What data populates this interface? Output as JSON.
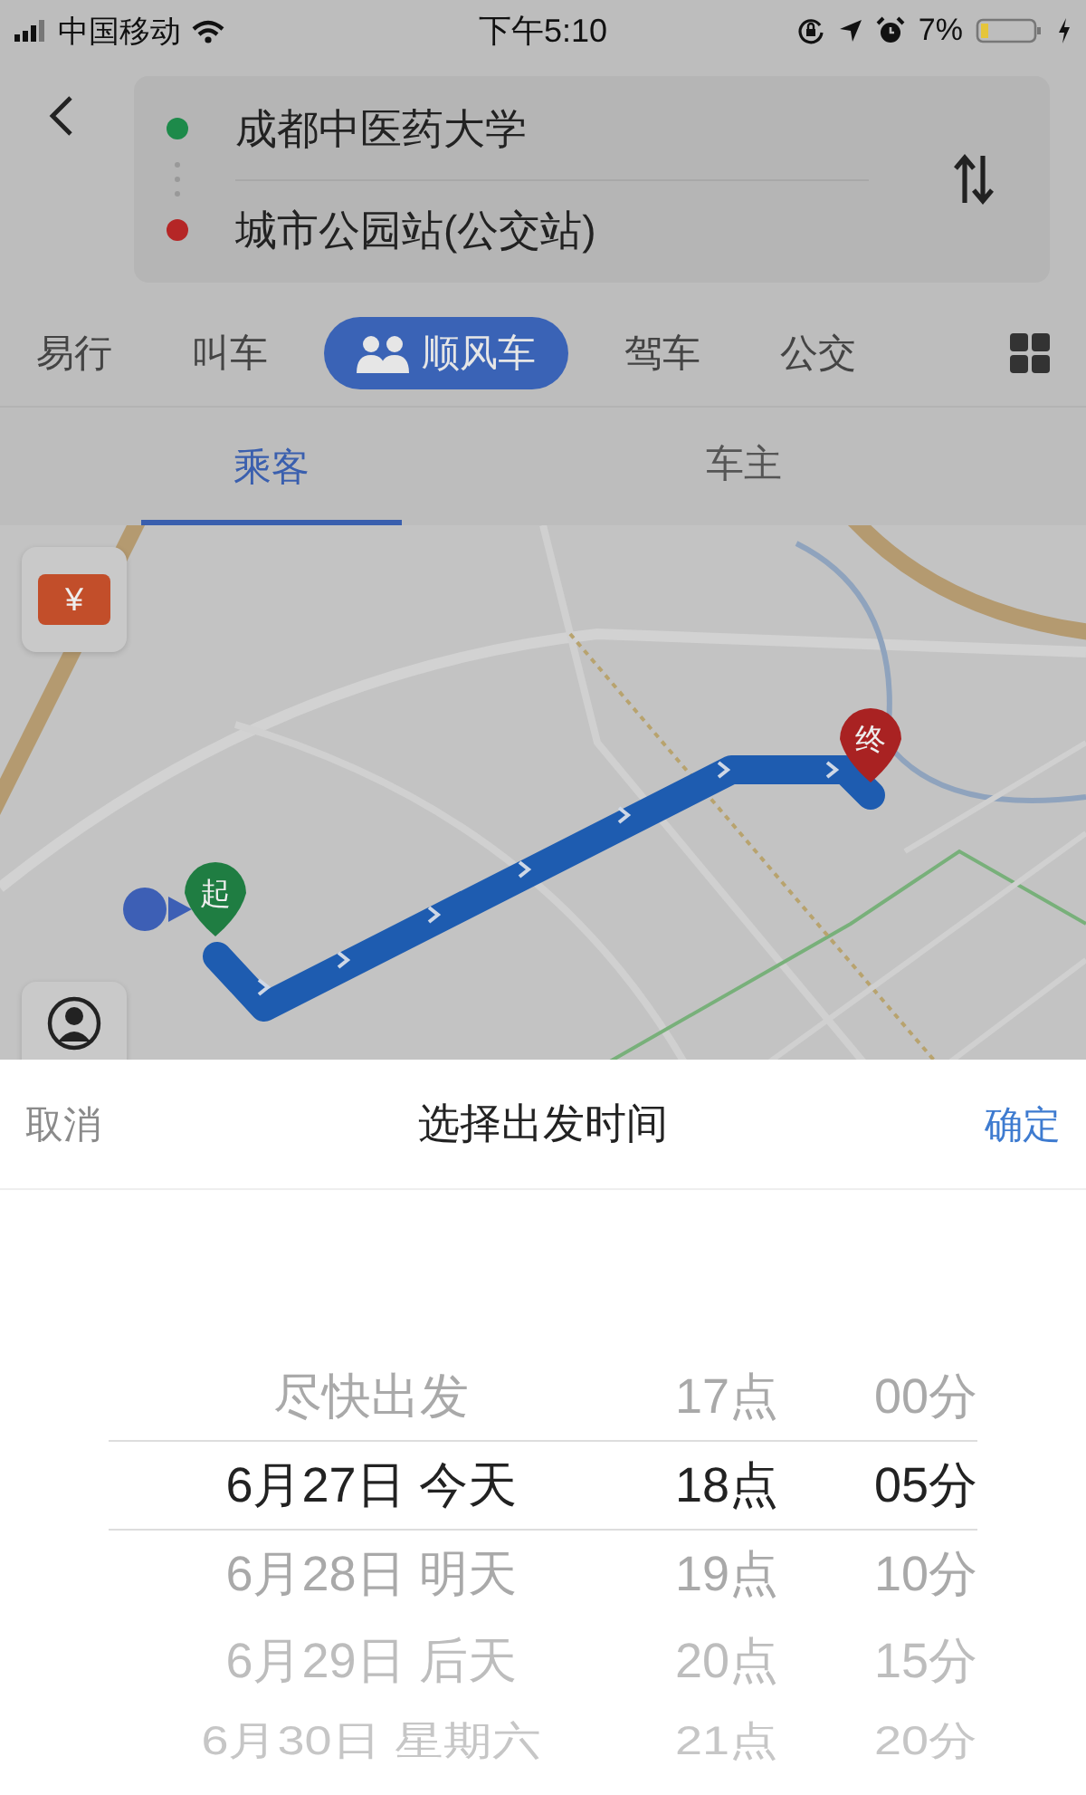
{
  "status_bar": {
    "carrier": "中国移动",
    "time": "下午5:10",
    "battery": "7%"
  },
  "route": {
    "origin": "成都中医药大学",
    "destination": "城市公园站(公交站)"
  },
  "modes": [
    {
      "label": "易行",
      "selected": false,
      "has_icon": false
    },
    {
      "label": "叫车",
      "selected": false,
      "has_icon": false
    },
    {
      "label": "顺风车",
      "selected": true,
      "has_icon": true
    },
    {
      "label": "驾车",
      "selected": false,
      "has_icon": false
    },
    {
      "label": "公交",
      "selected": false,
      "has_icon": false
    }
  ],
  "roles": [
    {
      "label": "乘客",
      "selected": true
    },
    {
      "label": "车主",
      "selected": false
    }
  ],
  "map": {
    "coupon_symbol": "¥",
    "markers": [
      {
        "kind": "start",
        "label": "起"
      },
      {
        "kind": "end",
        "label": "终"
      }
    ]
  },
  "time_picker": {
    "cancel": "取消",
    "title": "选择出发时间",
    "confirm": "确定",
    "rows": [
      {
        "date": "尽快出发",
        "hour": "17点",
        "minute": "00分",
        "selected": false
      },
      {
        "date": "6月27日 今天",
        "hour": "18点",
        "minute": "05分",
        "selected": true
      },
      {
        "date": "6月28日 明天",
        "hour": "19点",
        "minute": "10分",
        "selected": false
      },
      {
        "date": "6月29日 后天",
        "hour": "20点",
        "minute": "15分",
        "selected": false
      },
      {
        "date": "6月30日 星期六",
        "hour": "21点",
        "minute": "20分",
        "selected": false
      }
    ]
  }
}
